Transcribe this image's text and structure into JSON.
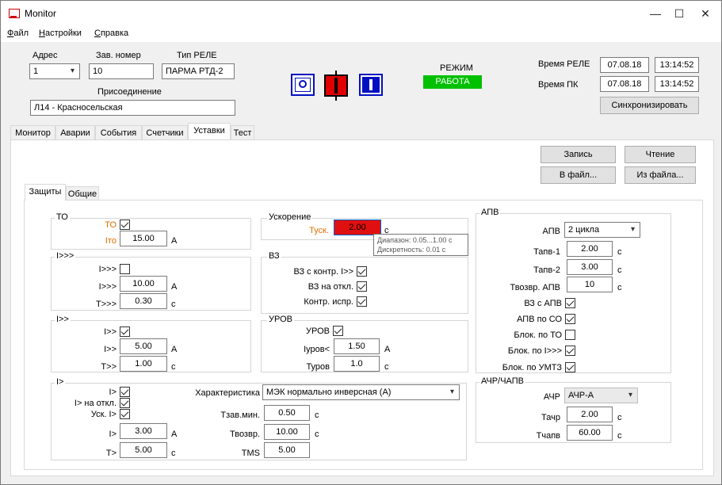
{
  "window": {
    "title": "Monitor",
    "min": "—",
    "max": "☐",
    "close": "✕"
  },
  "menu": [
    {
      "underline": "Ф",
      "rest": "айл"
    },
    {
      "underline": "Н",
      "rest": "астройки"
    },
    {
      "underline": "С",
      "rest": "правка"
    }
  ],
  "header": {
    "address_label": "Адрес",
    "address_value": "1",
    "serial_label": "Зав. номер",
    "serial_value": "10",
    "relay_type_label": "Тип РЕЛЕ",
    "relay_type_value": "ПАРМА РТД-2",
    "connection_label": "Присоединение",
    "connection_value": "Л14 - Красносельская",
    "mode_label": "РЕЖИМ",
    "mode_value": "РАБОТА",
    "mode_color": "#00c000",
    "relay_time_label": "Время РЕЛЕ",
    "relay_date": "07.08.18",
    "relay_time": "13:14:52",
    "pc_time_label": "Время ПК",
    "pc_date": "07.08.18",
    "pc_time": "13:14:52",
    "sync_button": "Синхронизировать",
    "icons": [
      "circle-button-icon",
      "breaker-closed-icon",
      "breaker-open-icon"
    ]
  },
  "tabs": [
    "Монитор",
    "Аварии",
    "События",
    "Счетчики",
    "Уставки",
    "Тест"
  ],
  "active_tab": "Уставки",
  "actions": {
    "write": "Запись",
    "read": "Чтение",
    "to_file": "В файл...",
    "from_file": "Из файла..."
  },
  "subtabs": [
    "Защиты",
    "Общие"
  ],
  "to": {
    "title": "ТО",
    "to_label": "ТО",
    "to_checked": true,
    "ito_label": "Iто",
    "ito_value": "15.00",
    "ito_unit": "А"
  },
  "i3": {
    "title": "I>>>",
    "en_label": "I>>>",
    "en_checked": false,
    "i_label": "I>>>",
    "i_value": "10.00",
    "i_unit": "А",
    "t_label": "T>>>",
    "t_value": "0.30",
    "t_unit": "с"
  },
  "i2": {
    "title": "I>>",
    "en_label": "I>>",
    "en_checked": true,
    "i_label": "I>>",
    "i_value": "5.00",
    "i_unit": "А",
    "t_label": "T>>",
    "t_value": "1.00",
    "t_unit": "с"
  },
  "i1": {
    "title": "I>",
    "en_label": "I>",
    "en_checked": true,
    "off_label": "I> на откл.",
    "off_checked": true,
    "acc_label": "Уск. I>",
    "acc_checked": true,
    "i_label": "I>",
    "i_value": "3.00",
    "i_unit": "А",
    "t_label": "T>",
    "t_value": "5.00",
    "t_unit": "с",
    "char_label": "Характеристика",
    "char_value": "МЭК нормально инверсная (А)",
    "tmin_label": "Тзав.мин.",
    "tmin_value": "0.50",
    "tmin_unit": "с",
    "tret_label": "Твозвр.",
    "tret_value": "10.00",
    "tret_unit": "с",
    "tms_label": "TMS",
    "tms_value": "5.00"
  },
  "accel": {
    "title": "Ускорение",
    "t_label": "Туск.",
    "t_value": "2.00",
    "t_unit": "с",
    "tooltip_range": "Диапазон: 0.05...1.00 с",
    "tooltip_step": "Дискретность: 0.01 с"
  },
  "vz": {
    "title": "ВЗ",
    "items": [
      {
        "label": "ВЗ с контр. I>>",
        "checked": true
      },
      {
        "label": "ВЗ на откл.",
        "checked": true
      },
      {
        "label": "Контр. испр.",
        "checked": true
      }
    ]
  },
  "urov": {
    "title": "УРОВ",
    "en_label": "УРОВ",
    "en_checked": true,
    "i_label": "Iуров<",
    "i_value": "1.50",
    "i_unit": "А",
    "t_label": "Туров",
    "t_value": "1.0",
    "t_unit": "с"
  },
  "apv": {
    "title": "АПВ",
    "mode_label": "АПВ",
    "mode_value": "2 цикла",
    "t1_label": "Тапв-1",
    "t1_value": "2.00",
    "t1_unit": "с",
    "t2_label": "Тапв-2",
    "t2_value": "3.00",
    "t2_unit": "с",
    "tr_label": "Твозвр. АПВ",
    "tr_value": "10",
    "tr_unit": "с",
    "flags": [
      {
        "label": "ВЗ с АПВ",
        "checked": true
      },
      {
        "label": "АПВ по СО",
        "checked": true
      },
      {
        "label": "Блок. по ТО",
        "checked": false
      },
      {
        "label": "Блок. по I>>>",
        "checked": true
      },
      {
        "label": "Блок. по УМТЗ",
        "checked": true
      }
    ]
  },
  "achr": {
    "title": "АЧР/ЧАПВ",
    "mode_label": "АЧР",
    "mode_value": "АЧР-А",
    "t1_label": "Тачр",
    "t1_value": "2.00",
    "t1_unit": "с",
    "t2_label": "Тчапв",
    "t2_value": "60.00",
    "t2_unit": "с"
  }
}
